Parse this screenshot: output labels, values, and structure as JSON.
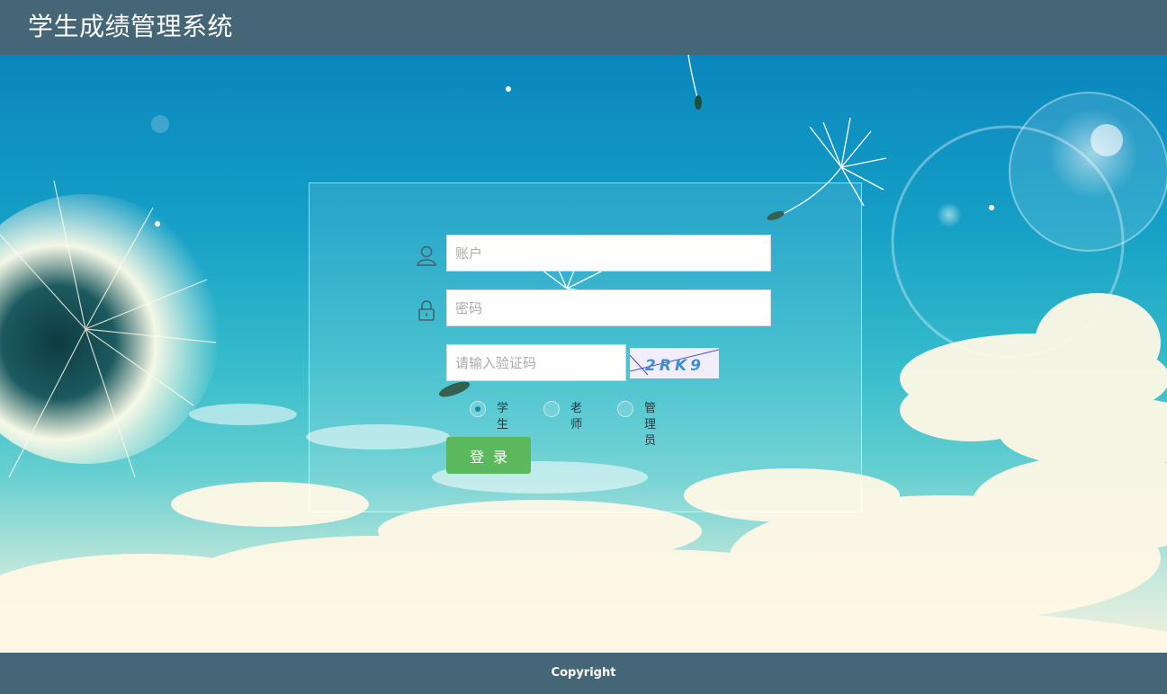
{
  "header": {
    "title": "学生成绩管理系统"
  },
  "login": {
    "account_placeholder": "账户",
    "password_placeholder": "密码",
    "captcha_placeholder": "请输入验证码",
    "captcha_text": "2 R K 9",
    "roles": [
      {
        "label": "学生",
        "selected": true
      },
      {
        "label": "老师",
        "selected": false
      },
      {
        "label": "管理员",
        "selected": false
      }
    ],
    "submit_label": "登录"
  },
  "footer": {
    "copyright": "Copyright"
  },
  "colors": {
    "header_bg": "#456676",
    "button_bg": "#5cb85c",
    "sky": "#0a86bd"
  },
  "icons": [
    "user-icon",
    "lock-icon"
  ]
}
